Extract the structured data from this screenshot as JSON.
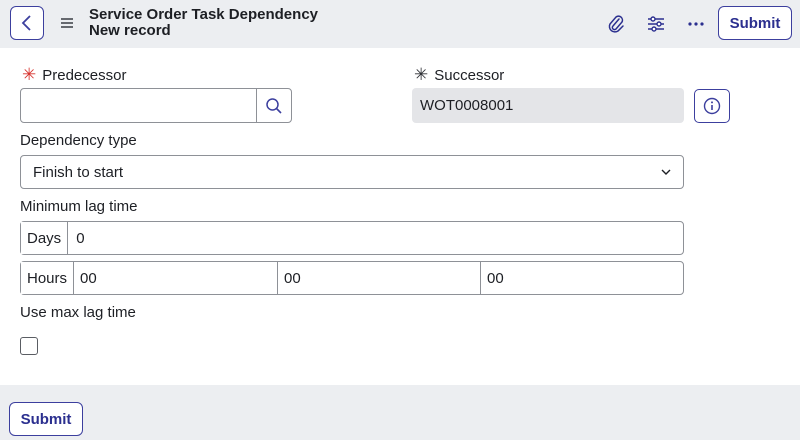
{
  "header": {
    "title": "Service Order Task Dependency",
    "subtitle": "New record",
    "submit_label": "Submit",
    "icons": [
      "back-icon",
      "menu-icon",
      "paperclip-icon",
      "settings-sliders-icon",
      "more-icon"
    ]
  },
  "form": {
    "predecessor": {
      "label": "Predecessor",
      "required_mark": "✳",
      "value": ""
    },
    "successor": {
      "label": "Successor",
      "required_mark": "✳",
      "value": "WOT0008001"
    },
    "dependency_type": {
      "label": "Dependency type",
      "value": "Finish to start"
    },
    "min_lag": {
      "label": "Minimum lag time",
      "days_label": "Days",
      "days_value": "0",
      "hours_label": "Hours",
      "hours_value": "00",
      "minutes_value": "00",
      "seconds_value": "00"
    },
    "use_max_lag": {
      "label": "Use max lag time",
      "checked": false
    }
  },
  "footer": {
    "submit_label": "Submit"
  },
  "colors": {
    "accent": "#3c3f9e",
    "required_red": "#d6322d",
    "header_bg": "#eceef1",
    "readonly_bg": "#e4e5e8"
  }
}
